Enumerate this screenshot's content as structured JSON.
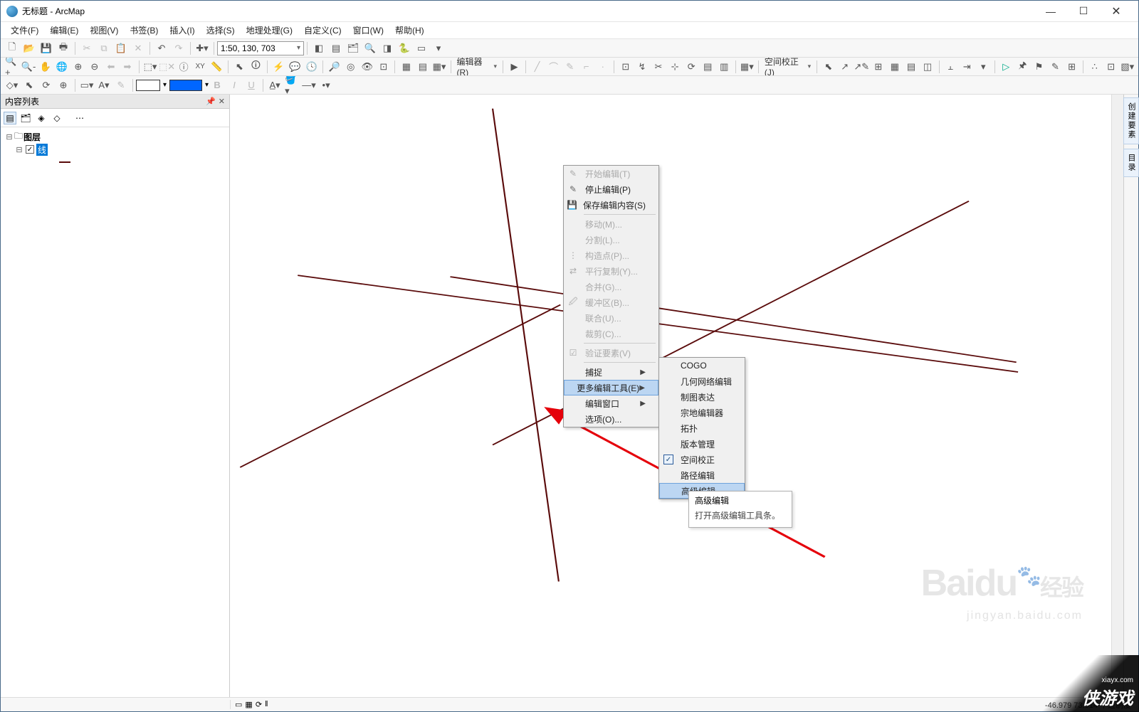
{
  "title": "无标题 - ArcMap",
  "menu": [
    "文件(F)",
    "编辑(E)",
    "视图(V)",
    "书签(B)",
    "插入(I)",
    "选择(S)",
    "地理处理(G)",
    "自定义(C)",
    "窗口(W)",
    "帮助(H)"
  ],
  "scale": "1:50, 130, 703",
  "toolbar2_labels": {
    "editor": "编辑器(R)",
    "spatial_adjust": "空间校正(J)"
  },
  "toc": {
    "title": "内容列表",
    "root": "图层",
    "layer": "线"
  },
  "editor_menu": [
    {
      "label": "开始编辑(T)",
      "icon": "✎",
      "disabled": true
    },
    {
      "label": "停止编辑(P)",
      "icon": "✎",
      "disabled": false
    },
    {
      "label": "保存编辑内容(S)",
      "icon": "💾",
      "disabled": false
    },
    {
      "sep": true
    },
    {
      "label": "移动(M)...",
      "disabled": true
    },
    {
      "label": "分割(L)...",
      "disabled": true
    },
    {
      "label": "构造点(P)...",
      "icon": "⋮",
      "disabled": true
    },
    {
      "label": "平行复制(Y)...",
      "icon": "⇄",
      "disabled": true
    },
    {
      "label": "合并(G)...",
      "disabled": true
    },
    {
      "label": "缓冲区(B)...",
      "icon": "🖉",
      "disabled": true
    },
    {
      "label": "联合(U)...",
      "disabled": true
    },
    {
      "label": "裁剪(C)...",
      "disabled": true
    },
    {
      "sep": true
    },
    {
      "label": "验证要素(V)",
      "icon": "☑",
      "disabled": true
    },
    {
      "sep": true
    },
    {
      "label": "捕捉",
      "sub": true
    },
    {
      "label": "更多编辑工具(E)",
      "sub": true,
      "highlight": true
    },
    {
      "label": "编辑窗口",
      "sub": true
    },
    {
      "label": "选项(O)..."
    }
  ],
  "more_tools_menu": [
    {
      "label": "COGO"
    },
    {
      "label": "几何网络编辑"
    },
    {
      "label": "制图表达"
    },
    {
      "label": "宗地编辑器"
    },
    {
      "label": "拓扑"
    },
    {
      "label": "版本管理"
    },
    {
      "label": "空间校正",
      "checked": true
    },
    {
      "label": "路径编辑"
    },
    {
      "label": "高级编辑",
      "highlight": true
    }
  ],
  "tooltip": {
    "title": "高级编辑",
    "body": "打开高级编辑工具条。"
  },
  "side_tabs": [
    "创建要素",
    "目录"
  ],
  "status": {
    "coords": "-46.979  73.614 十进制度"
  },
  "watermark": {
    "brand": "Baidu",
    "brand_sub": "经验",
    "url": "jingyan.baidu.com",
    "site": "xiayx.com",
    "site_logo": "侠游戏"
  },
  "colors": {
    "accent": "#bcd6f2",
    "line": "#5a0b0b",
    "arrow": "#e5000a"
  }
}
